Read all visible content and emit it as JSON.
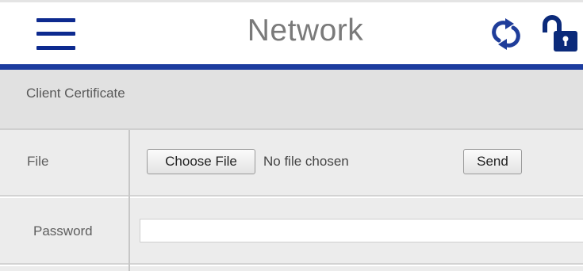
{
  "header": {
    "title": "Network",
    "menu_icon": "hamburger-menu-icon",
    "refresh_icon": "refresh-icon",
    "lock_icon": "unlocked-padlock-icon"
  },
  "colors": {
    "accent": "#1d3c9f",
    "menu_icon": "#0d2a8f",
    "refresh_icon": "#1f3d9a",
    "lock_icon": "#0b2a7a",
    "section_bg": "#e1e1e1",
    "row_bg": "#ececec"
  },
  "section": {
    "title": "Client Certificate"
  },
  "rows": {
    "file": {
      "label": "File",
      "choose_button": "Choose File",
      "status": "No file chosen",
      "send_button": "Send"
    },
    "password": {
      "label": "Password",
      "value": "",
      "placeholder": ""
    }
  }
}
